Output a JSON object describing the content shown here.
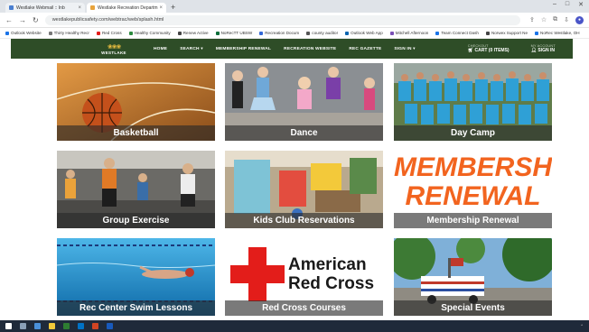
{
  "browser": {
    "tabs": [
      {
        "label": "Westlake Webmail :: Inb",
        "active": false
      },
      {
        "label": "Westlake Recreation Departm",
        "active": true
      }
    ],
    "url": "westlakepublicsafety.com/webtrac/web/splash.html",
    "bookmarks": [
      "Outlook Website",
      "Thirty Healthy Recr",
      "Red Cross",
      "Healthy Community",
      "Renew Active",
      "NoRecTT UBSW",
      "Recreation Docum",
      "county auditor",
      "Outlook Web App",
      "Mitchell Afternoon",
      "Team Connect Dash",
      "Norwex Support Ne",
      "NoRec Westlake, OH"
    ]
  },
  "site": {
    "logo_text": "WESTLAKE",
    "menu": [
      "HOME",
      "SEARCH ▾",
      "MEMBERSHIP RENEWAL",
      "RECREATION WEBSITE",
      "REC GAZETTE",
      "SIGN IN ▾"
    ],
    "checkout_label": "CHECKOUT",
    "cart_label": "CART (0 ITEMS)",
    "account_label": "MY ACCOUNT",
    "signin_label": "SIGN IN"
  },
  "tiles": [
    {
      "id": "basketball",
      "label": "Basketball"
    },
    {
      "id": "dance",
      "label": "Dance"
    },
    {
      "id": "day-camp",
      "label": "Day Camp"
    },
    {
      "id": "group-exercise",
      "label": "Group Exercise"
    },
    {
      "id": "kids-club",
      "label": "Kids Club Reservations"
    },
    {
      "id": "membership-renewal",
      "label": "Membership Renewal",
      "banner_line1": "MEMBERSHIP",
      "banner_line2": "RENEWAL"
    },
    {
      "id": "swim-lessons",
      "label": "Rec Center Swim Lessons"
    },
    {
      "id": "red-cross",
      "label": "Red Cross Courses",
      "logo_line1": "American",
      "logo_line2": "Red Cross"
    },
    {
      "id": "special-events",
      "label": "Special Events"
    }
  ],
  "colors": {
    "nav_bg": "#2e4d27",
    "membership_orange": "#f2641f",
    "red_cross": "#e31d1a"
  }
}
